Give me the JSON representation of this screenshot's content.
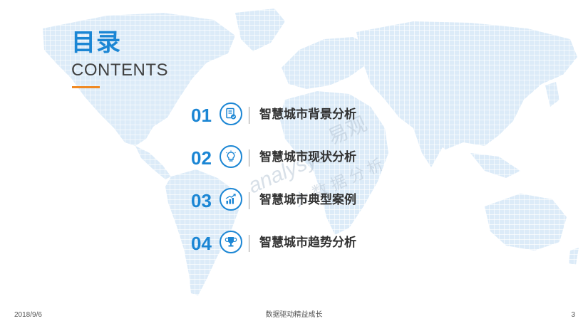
{
  "title": {
    "cn": "目录",
    "en": "CONTENTS"
  },
  "accent_color": "#1b86d4",
  "underline_color": "#f08a24",
  "toc": [
    {
      "num": "01",
      "label": "智慧城市背景分析",
      "icon": "document-check-icon"
    },
    {
      "num": "02",
      "label": "智慧城市现状分析",
      "icon": "lightbulb-icon"
    },
    {
      "num": "03",
      "label": "智慧城市典型案例",
      "icon": "bar-chart-trend-icon"
    },
    {
      "num": "04",
      "label": "智慧城市趋势分析",
      "icon": "trophy-icon"
    }
  ],
  "watermark": {
    "brand": "analysys",
    "cn": "易观",
    "cn2": "大数据分析"
  },
  "footer": {
    "date": "2018/9/6",
    "center": "数据驱动精益成长",
    "page": "3"
  }
}
